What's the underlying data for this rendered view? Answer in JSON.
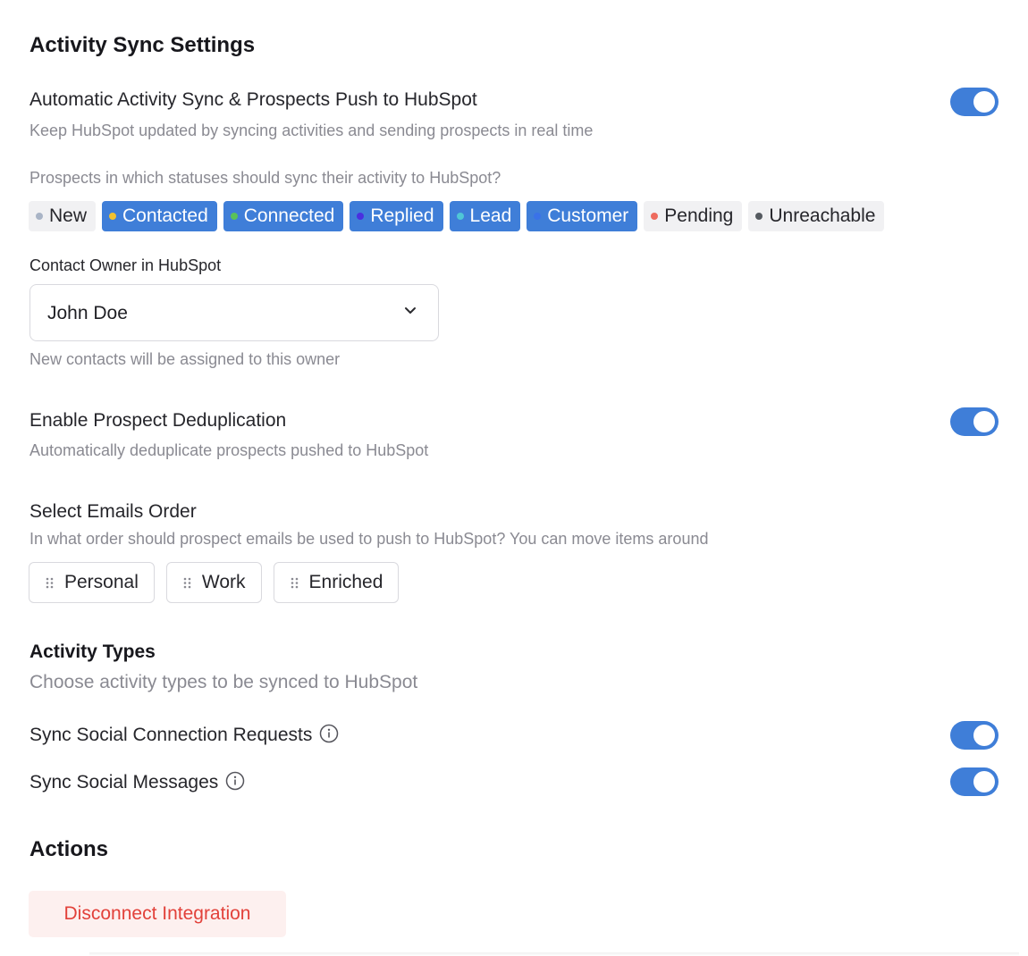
{
  "header": {
    "title": "Activity Sync Settings"
  },
  "auto_sync": {
    "label": "Automatic Activity Sync & Prospects Push to HubSpot",
    "description": "Keep HubSpot updated by syncing activities and sending prospects in real time",
    "enabled": true
  },
  "statuses": {
    "question": "Prospects in which statuses should sync their activity to HubSpot?",
    "items": [
      {
        "label": "New",
        "selected": false,
        "dot_color": "#a9b4c6"
      },
      {
        "label": "Contacted",
        "selected": true,
        "dot_color": "#f2c230"
      },
      {
        "label": "Connected",
        "selected": true,
        "dot_color": "#5ac25a"
      },
      {
        "label": "Replied",
        "selected": true,
        "dot_color": "#4a2fe0"
      },
      {
        "label": "Lead",
        "selected": true,
        "dot_color": "#4fc7d6"
      },
      {
        "label": "Customer",
        "selected": true,
        "dot_color": "#3a72e8"
      },
      {
        "label": "Pending",
        "selected": false,
        "dot_color": "#ee6b5e"
      },
      {
        "label": "Unreachable",
        "selected": false,
        "dot_color": "#555a60"
      }
    ]
  },
  "owner": {
    "label": "Contact Owner in HubSpot",
    "selected": "John Doe",
    "hint": "New contacts will be assigned to this owner"
  },
  "dedup": {
    "label": "Enable Prospect Deduplication",
    "description": "Automatically deduplicate prospects pushed to HubSpot",
    "enabled": true
  },
  "emails_order": {
    "label": "Select Emails Order",
    "description": "In what order should prospect emails be used to push to HubSpot? You can move items around",
    "items": [
      "Personal",
      "Work",
      "Enriched"
    ]
  },
  "activity_types": {
    "title": "Activity Types",
    "description": "Choose activity types to be synced to HubSpot",
    "items": [
      {
        "label": "Sync Social Connection Requests",
        "enabled": true,
        "icon": "info-icon"
      },
      {
        "label": "Sync Social Messages",
        "enabled": true,
        "icon": "info-icon"
      }
    ]
  },
  "actions": {
    "title": "Actions",
    "disconnect_label": "Disconnect Integration"
  },
  "colors": {
    "accent": "#3f7ed8",
    "danger_text": "#e2413a",
    "danger_bg": "#fdf0ef"
  }
}
